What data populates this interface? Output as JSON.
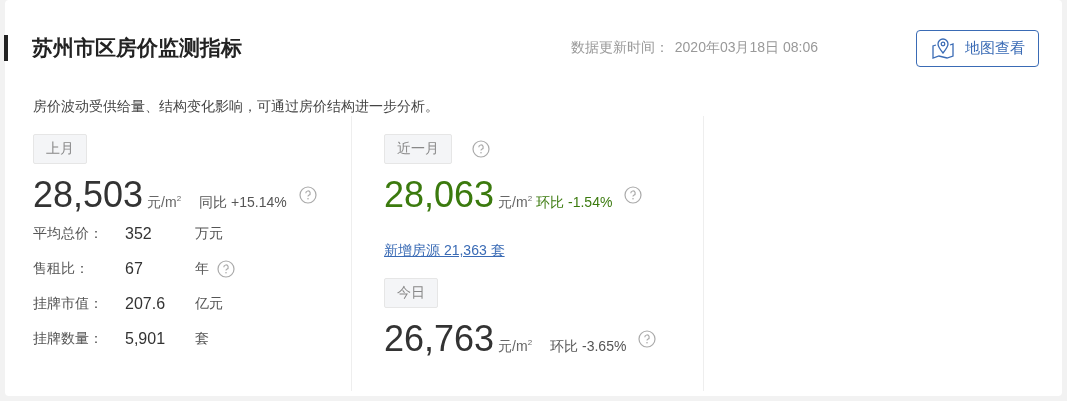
{
  "header": {
    "title": "苏州市区房价监测指标",
    "update_label": "数据更新时间：",
    "update_time": "2020年03月18日 08:06",
    "map_button": "地图查看"
  },
  "description": "房价波动受供给量、结构变化影响，可通过房价结构进一步分析。",
  "last_month": {
    "tag": "上月",
    "tag_help": false,
    "price": "28,503",
    "unit": "元/m$^{2}$",
    "change": {
      "text": "同比 +15.14%",
      "color": "#555555"
    },
    "color": "#333333",
    "help": true,
    "stats": [
      {
        "label": "平均总价：",
        "value": "352",
        "unit": "万元",
        "help": false
      },
      {
        "label": "售租比：",
        "value": "67",
        "unit": "年",
        "help": true
      },
      {
        "label": "挂牌市值：",
        "value": "207.6",
        "unit": "亿元",
        "help": false
      },
      {
        "label": "挂牌数量：",
        "value": "5,901",
        "unit": "套",
        "help": false
      }
    ]
  },
  "recent_month": {
    "tag": "近一月",
    "tag_help": true,
    "price": "28,063",
    "unit": "元/m$^{2}$",
    "change": {
      "text": "环比 -1.54%",
      "color": "#3b7a0e"
    },
    "color": "#3b7a0e",
    "help": true,
    "new_listings": "新增房源 21,363 套"
  },
  "today": {
    "tag": "今日",
    "tag_help": false,
    "price": "26,763",
    "unit": "元/m$^{2}$",
    "change": {
      "text": "环比 -3.65%",
      "color": "#555555"
    },
    "color": "#333333",
    "help": true
  }
}
